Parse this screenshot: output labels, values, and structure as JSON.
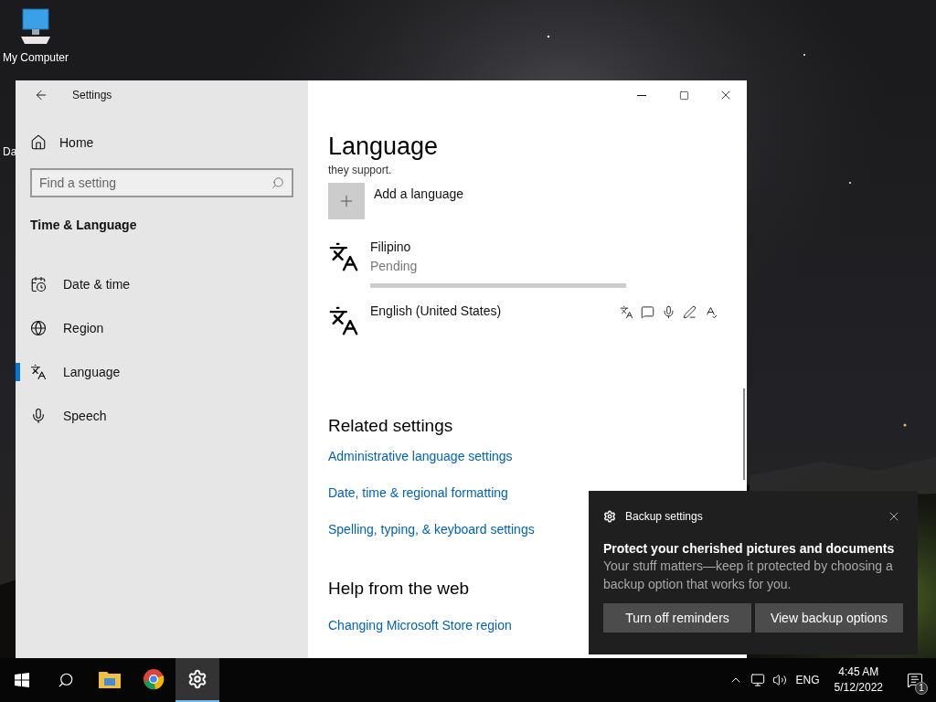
{
  "desktop": {
    "icons": [
      {
        "label": "My Computer",
        "kind": "computer"
      },
      {
        "label": "Da",
        "kind": "partial"
      }
    ]
  },
  "window": {
    "title": "Settings",
    "sidebar": {
      "home": "Home",
      "search": {
        "placeholder": "Find a setting"
      },
      "section": "Time & Language",
      "items": [
        {
          "label": "Date & time",
          "kind": "date",
          "selected": false
        },
        {
          "label": "Region",
          "kind": "region",
          "selected": false
        },
        {
          "label": "Language",
          "kind": "language",
          "selected": true
        },
        {
          "label": "Speech",
          "kind": "speech",
          "selected": false
        }
      ]
    },
    "content": {
      "title": "Language",
      "cut_text": "they support.",
      "add_button": "Add a language",
      "languages": [
        {
          "name": "Filipino",
          "status": "Pending",
          "kind": "pending",
          "level": 1
        },
        {
          "name": "English (United States)",
          "kind": "installed"
        }
      ],
      "related": {
        "title": "Related settings",
        "links": [
          "Administrative language settings",
          "Date, time & regional formatting",
          "Spelling, typing, & keyboard settings"
        ]
      },
      "help": {
        "title": "Help from the web",
        "links": [
          "Changing Microsoft Store region"
        ]
      }
    }
  },
  "toast": {
    "app": "Backup settings",
    "title": "Protect your cherished pictures and documents",
    "body": "Your stuff matters—keep it protected by choosing a backup option that works for you.",
    "buttons": [
      "Turn off reminders",
      "View backup options"
    ]
  },
  "taskbar": {
    "apps": [
      {
        "kind": "folder",
        "selected": false
      },
      {
        "kind": "browser",
        "selected": false
      },
      {
        "kind": "settings",
        "selected": true
      }
    ],
    "language": "ENG",
    "time": "4:45 AM",
    "date": "5/12/2022",
    "notifications": "1"
  }
}
